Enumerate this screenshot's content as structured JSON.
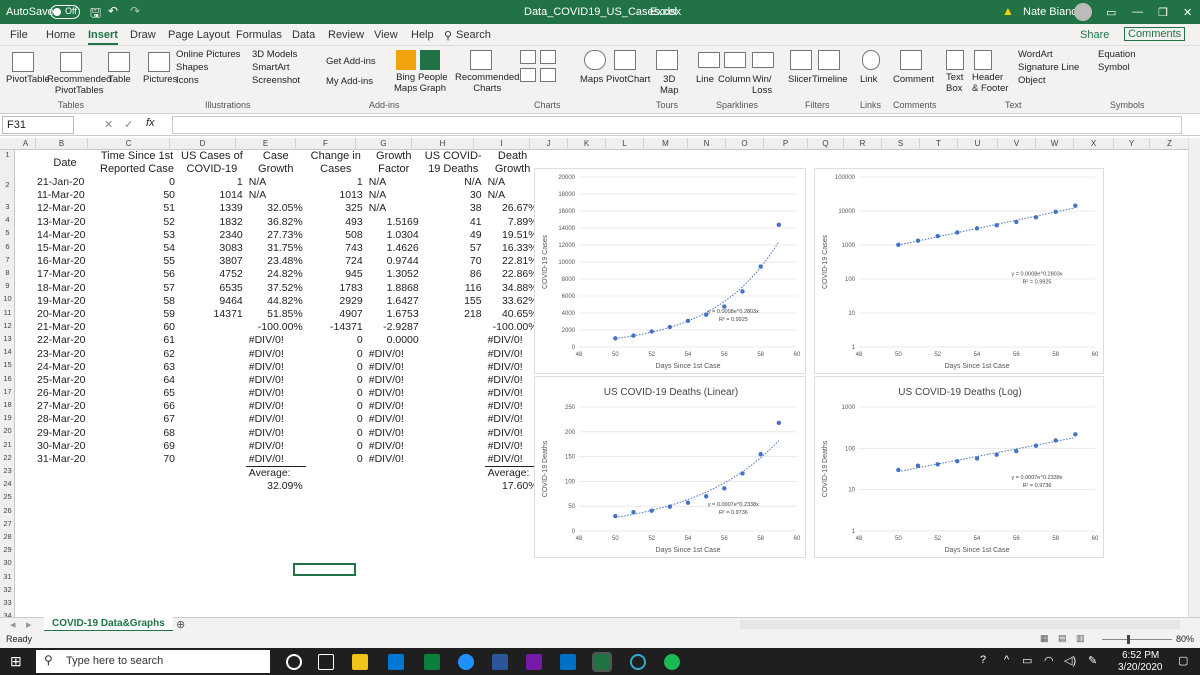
{
  "titlebar": {
    "autosave": "AutoSave",
    "off": "Off",
    "file": "Data_COVID19_US_Cases.xlsx",
    "app": "Excel",
    "user": "Nate Bianco"
  },
  "tabs": [
    "File",
    "Home",
    "Insert",
    "Draw",
    "Page Layout",
    "Formulas",
    "Data",
    "Review",
    "View",
    "Help",
    "Search"
  ],
  "share": "Share",
  "comments": "Comments",
  "ribbon": {
    "pivot": "PivotTable",
    "recpivot": "Recommended\nPivotTables",
    "table": "Table",
    "pictures": "Pictures",
    "online": "Online Pictures",
    "shapes": "Shapes",
    "icons": "Icons",
    "models": "3D Models",
    "smartart": "SmartArt",
    "screenshot": "Screenshot",
    "getaddins": "Get Add-ins",
    "myaddins": "My Add-ins",
    "bing": "Bing\nMaps",
    "people": "People\nGraph",
    "reccharts": "Recommended\nCharts",
    "maps": "Maps",
    "pivotchart": "PivotChart",
    "map3d": "3D\nMap",
    "line": "Line",
    "column": "Column",
    "winloss": "Win/\nLoss",
    "slicer": "Slicer",
    "timeline": "Timeline",
    "link": "Link",
    "comment": "Comment",
    "textbox": "Text\nBox",
    "header": "Header\n& Footer",
    "wordart": "WordArt",
    "sigline": "Signature Line",
    "object": "Object",
    "equation": "Equation",
    "symbol": "Symbol",
    "groups": [
      "Tables",
      "Illustrations",
      "Add-ins",
      "Charts",
      "Tours",
      "Sparklines",
      "Filters",
      "Links",
      "Comments",
      "Text",
      "Symbols"
    ]
  },
  "namebox": "F31",
  "fx": "fx",
  "columns": [
    "A",
    "B",
    "C",
    "D",
    "E",
    "F",
    "G",
    "H",
    "I",
    "J",
    "K",
    "L",
    "M",
    "N",
    "O",
    "P",
    "Q",
    "R",
    "S",
    "T",
    "U",
    "V",
    "W",
    "X",
    "Y",
    "Z"
  ],
  "rows": [
    "1",
    "2",
    "3",
    "4",
    "5",
    "6",
    "7",
    "8",
    "9",
    "10",
    "11",
    "12",
    "13",
    "14",
    "15",
    "16",
    "17",
    "18",
    "19",
    "20",
    "21",
    "22",
    "23",
    "24",
    "25",
    "26",
    "27",
    "28",
    "29",
    "30",
    "31",
    "32",
    "33",
    "34",
    "35"
  ],
  "table": {
    "headers": [
      [
        "Date",
        ""
      ],
      [
        "Time Since 1st",
        "Reported Case"
      ],
      [
        "US Cases of",
        "COVID-19"
      ],
      [
        "Case",
        "Growth"
      ],
      [
        "Change in",
        "Cases"
      ],
      [
        "Growth",
        "Factor"
      ],
      [
        "US COVID-",
        "19 Deaths"
      ],
      [
        "Death",
        "Growth"
      ]
    ],
    "rows": [
      [
        "21-Jan-20",
        "0",
        "1",
        "N/A",
        "1",
        "N/A",
        "N/A",
        "N/A"
      ],
      [
        "11-Mar-20",
        "50",
        "1014",
        "N/A",
        "1013",
        "N/A",
        "30",
        "N/A"
      ],
      [
        "12-Mar-20",
        "51",
        "1339",
        "32.05%",
        "325",
        "N/A",
        "38",
        "26.67%"
      ],
      [
        "13-Mar-20",
        "52",
        "1832",
        "36.82%",
        "493",
        "1.5169",
        "41",
        "7.89%"
      ],
      [
        "14-Mar-20",
        "53",
        "2340",
        "27.73%",
        "508",
        "1.0304",
        "49",
        "19.51%"
      ],
      [
        "15-Mar-20",
        "54",
        "3083",
        "31.75%",
        "743",
        "1.4626",
        "57",
        "16.33%"
      ],
      [
        "16-Mar-20",
        "55",
        "3807",
        "23.48%",
        "724",
        "0.9744",
        "70",
        "22.81%"
      ],
      [
        "17-Mar-20",
        "56",
        "4752",
        "24.82%",
        "945",
        "1.3052",
        "86",
        "22.86%"
      ],
      [
        "18-Mar-20",
        "57",
        "6535",
        "37.52%",
        "1783",
        "1.8868",
        "116",
        "34.88%"
      ],
      [
        "19-Mar-20",
        "58",
        "9464",
        "44.82%",
        "2929",
        "1.6427",
        "155",
        "33.62%"
      ],
      [
        "20-Mar-20",
        "59",
        "14371",
        "51.85%",
        "4907",
        "1.6753",
        "218",
        "40.65%"
      ],
      [
        "21-Mar-20",
        "60",
        "",
        "-100.00%",
        "-14371",
        "-2.9287",
        "",
        "-100.00%"
      ],
      [
        "22-Mar-20",
        "61",
        "",
        "#DIV/0!",
        "0",
        "0.0000",
        "",
        "#DIV/0!"
      ],
      [
        "23-Mar-20",
        "62",
        "",
        "#DIV/0!",
        "0",
        "#DIV/0!",
        "",
        "#DIV/0!"
      ],
      [
        "24-Mar-20",
        "63",
        "",
        "#DIV/0!",
        "0",
        "#DIV/0!",
        "",
        "#DIV/0!"
      ],
      [
        "25-Mar-20",
        "64",
        "",
        "#DIV/0!",
        "0",
        "#DIV/0!",
        "",
        "#DIV/0!"
      ],
      [
        "26-Mar-20",
        "65",
        "",
        "#DIV/0!",
        "0",
        "#DIV/0!",
        "",
        "#DIV/0!"
      ],
      [
        "27-Mar-20",
        "66",
        "",
        "#DIV/0!",
        "0",
        "#DIV/0!",
        "",
        "#DIV/0!"
      ],
      [
        "28-Mar-20",
        "67",
        "",
        "#DIV/0!",
        "0",
        "#DIV/0!",
        "",
        "#DIV/0!"
      ],
      [
        "29-Mar-20",
        "68",
        "",
        "#DIV/0!",
        "0",
        "#DIV/0!",
        "",
        "#DIV/0!"
      ],
      [
        "30-Mar-20",
        "69",
        "",
        "#DIV/0!",
        "0",
        "#DIV/0!",
        "",
        "#DIV/0!"
      ],
      [
        "31-Mar-20",
        "70",
        "",
        "#DIV/0!",
        "0",
        "#DIV/0!",
        "",
        "#DIV/0!"
      ],
      [
        "",
        "",
        "",
        "Average:",
        "",
        "",
        "",
        "Average:"
      ],
      [
        "",
        "",
        "",
        "32.09%",
        "",
        "",
        "",
        "17.60%"
      ]
    ]
  },
  "chart_data": [
    {
      "type": "scatter",
      "title": "",
      "xlabel": "Days Since 1st Case",
      "ylabel": "COVID-19 Cases",
      "xlim": [
        48,
        60
      ],
      "ylim": [
        0,
        20000
      ],
      "yticks": [
        "0",
        "2000",
        "4000",
        "6000",
        "8000",
        "10000",
        "12000",
        "14000",
        "16000",
        "18000",
        "20000"
      ],
      "xticks": [
        "48",
        "50",
        "52",
        "54",
        "56",
        "58",
        "60"
      ],
      "x": [
        50,
        51,
        52,
        53,
        54,
        55,
        56,
        57,
        58,
        59
      ],
      "y": [
        1014,
        1339,
        1832,
        2340,
        3083,
        3807,
        4752,
        6535,
        9464,
        14371
      ],
      "trendline": "y = 0.0008e^0.2803x",
      "r2": "R² = 0.9925"
    },
    {
      "type": "scatter",
      "title": "",
      "xlabel": "Days Since 1st Case",
      "ylabel": "COVID-19 Cases",
      "log": true,
      "xlim": [
        48,
        60
      ],
      "ylim": [
        1,
        100000
      ],
      "yticks": [
        "1",
        "10",
        "100",
        "1000",
        "10000",
        "100000"
      ],
      "xticks": [
        "48",
        "50",
        "52",
        "54",
        "56",
        "58",
        "60"
      ],
      "x": [
        50,
        51,
        52,
        53,
        54,
        55,
        56,
        57,
        58,
        59
      ],
      "y": [
        1014,
        1339,
        1832,
        2340,
        3083,
        3807,
        4752,
        6535,
        9464,
        14371
      ],
      "trendline": "y = 0.0008e^0.2803x",
      "r2": "R² = 0.9925"
    },
    {
      "type": "scatter",
      "title": "US COVID-19 Deaths (Linear)",
      "xlabel": "Days Since 1st Case",
      "ylabel": "COVID-19 Deaths",
      "xlim": [
        48,
        60
      ],
      "ylim": [
        0,
        250
      ],
      "yticks": [
        "0",
        "50",
        "100",
        "150",
        "200",
        "250"
      ],
      "xticks": [
        "48",
        "50",
        "52",
        "54",
        "56",
        "58",
        "60"
      ],
      "x": [
        50,
        51,
        52,
        53,
        54,
        55,
        56,
        57,
        58,
        59
      ],
      "y": [
        30,
        38,
        41,
        49,
        57,
        70,
        86,
        116,
        155,
        218
      ],
      "trendline": "y = 0.0007e^0.2338x",
      "r2": "R² = 0.9736"
    },
    {
      "type": "scatter",
      "title": "US COVID-19 Deaths (Log)",
      "xlabel": "Days Since 1st Case",
      "ylabel": "COVID-19 Deaths",
      "log": true,
      "xlim": [
        48,
        60
      ],
      "ylim": [
        1,
        1000
      ],
      "yticks": [
        "1",
        "10",
        "100",
        "1000"
      ],
      "xticks": [
        "48",
        "50",
        "52",
        "54",
        "56",
        "58",
        "60"
      ],
      "x": [
        50,
        51,
        52,
        53,
        54,
        55,
        56,
        57,
        58,
        59
      ],
      "y": [
        30,
        38,
        41,
        49,
        57,
        70,
        86,
        116,
        155,
        218
      ],
      "trendline": "y = 0.0007e^0.2338x",
      "r2": "R² = 0.9736"
    }
  ],
  "sheet_tab": "COVID-19 Data&Graphs",
  "status": {
    "ready": "Ready",
    "zoom": "80%"
  },
  "taskbar": {
    "search": "Type here to search",
    "time": "6:52 PM",
    "date": "3/20/2020"
  },
  "colors": {
    "excel": "#217346",
    "point": "#4472c4"
  }
}
